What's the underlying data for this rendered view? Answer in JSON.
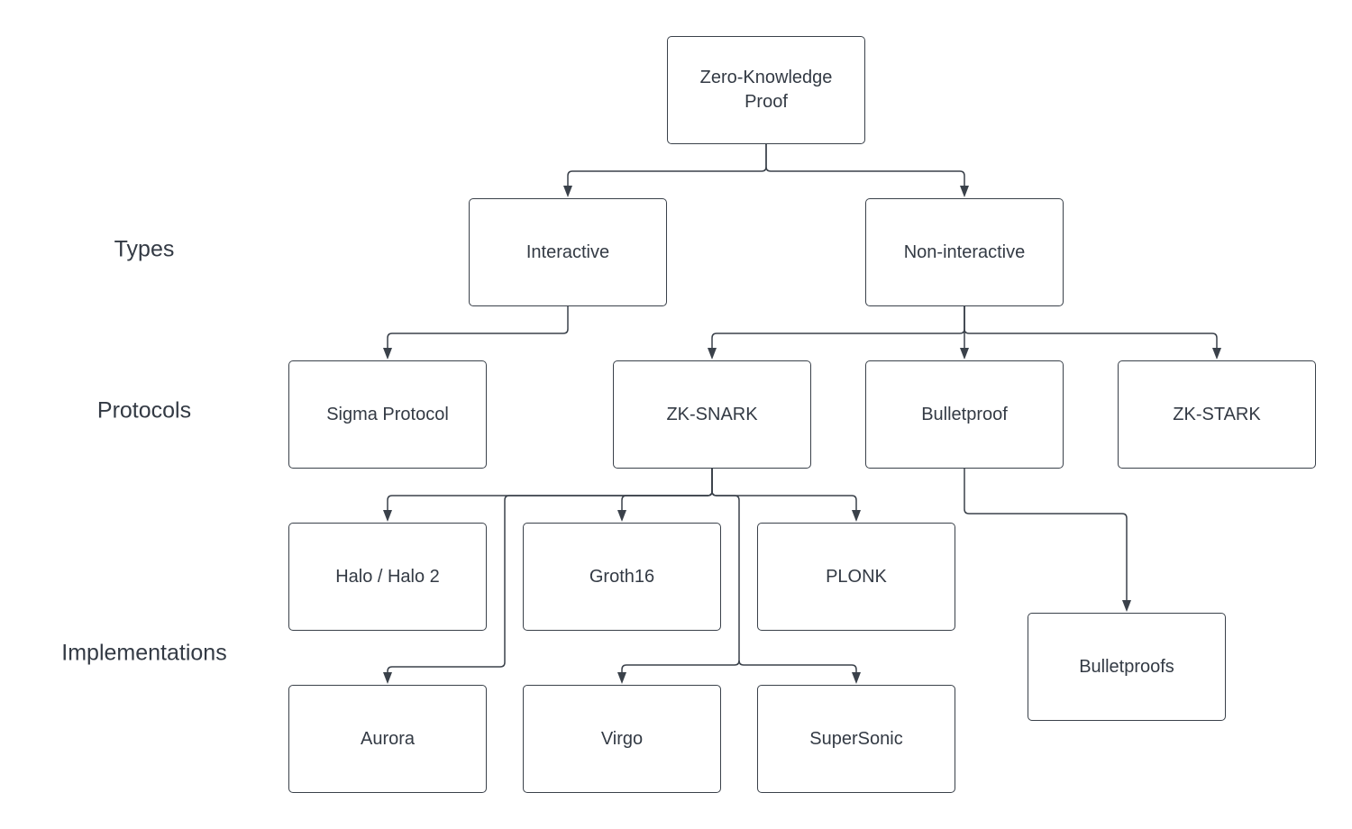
{
  "levels": {
    "types": "Types",
    "protocols": "Protocols",
    "implementations": "Implementations"
  },
  "nodes": {
    "root": "Zero-Knowledge Proof",
    "interactive": "Interactive",
    "non_interactive": "Non-interactive",
    "sigma": "Sigma Protocol",
    "zksnark": "ZK-SNARK",
    "bulletproof": "Bulletproof",
    "zkstark": "ZK-STARK",
    "halo": "Halo / Halo 2",
    "groth16": "Groth16",
    "plonk": "PLONK",
    "bulletproofs": "Bulletproofs",
    "aurora": "Aurora",
    "virgo": "Virgo",
    "supersonic": "SuperSonic"
  },
  "edges": [
    [
      "root",
      "interactive"
    ],
    [
      "root",
      "non_interactive"
    ],
    [
      "interactive",
      "sigma"
    ],
    [
      "non_interactive",
      "zksnark"
    ],
    [
      "non_interactive",
      "bulletproof"
    ],
    [
      "non_interactive",
      "zkstark"
    ],
    [
      "zksnark",
      "halo"
    ],
    [
      "zksnark",
      "groth16"
    ],
    [
      "zksnark",
      "plonk"
    ],
    [
      "zksnark",
      "aurora"
    ],
    [
      "zksnark",
      "virgo"
    ],
    [
      "zksnark",
      "supersonic"
    ],
    [
      "bulletproof",
      "bulletproofs"
    ]
  ],
  "colors": {
    "stroke": "#3a414a",
    "text": "#333a44"
  }
}
